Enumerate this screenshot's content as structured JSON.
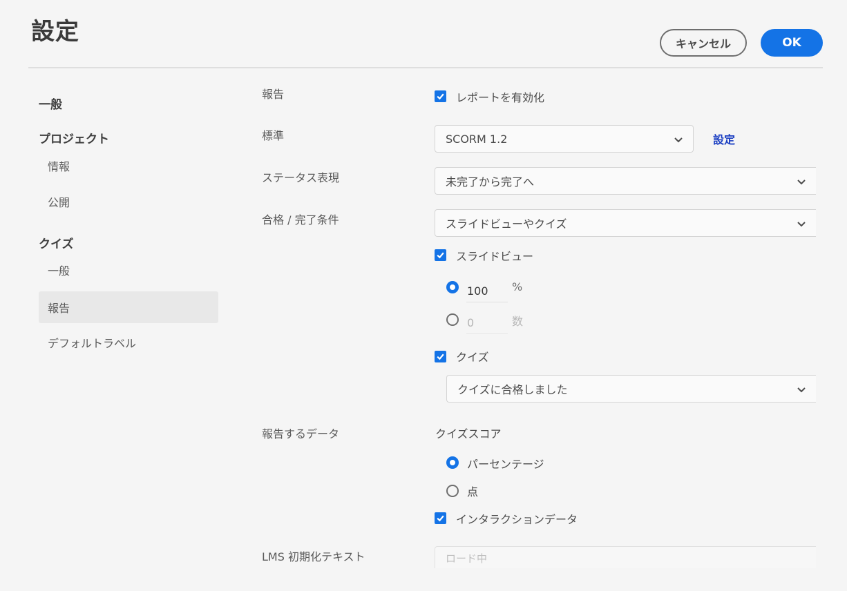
{
  "header": {
    "title": "設定",
    "cancel_label": "キャンセル",
    "ok_label": "OK"
  },
  "sidebar": {
    "general": "一般",
    "project": {
      "label": "プロジェクト",
      "items": [
        "情報",
        "公開"
      ]
    },
    "quiz": {
      "label": "クイズ",
      "items": [
        "一般",
        "報告",
        "デフォルトラベル"
      ],
      "selected": "報告"
    }
  },
  "form": {
    "reporting": {
      "label": "報告",
      "checkbox_label": "レポートを有効化",
      "checked": true
    },
    "standard": {
      "label": "標準",
      "value": "SCORM 1.2",
      "settings_link": "設定"
    },
    "status": {
      "label": "ステータス表現",
      "value": "未完了から完了へ"
    },
    "criteria": {
      "label": "合格 / 完了条件",
      "value": "スライドビューやクイズ",
      "slide_view": {
        "label": "スライドビュー",
        "checked": true,
        "percent_value": "100",
        "percent_unit": "%",
        "count_value": "0",
        "count_unit": "数",
        "selected": "percent"
      },
      "quiz": {
        "label": "クイズ",
        "checked": true,
        "value": "クイズに合格しました"
      }
    },
    "data": {
      "label": "報告するデータ",
      "heading": "クイズスコア",
      "options": [
        "パーセンテージ",
        "点"
      ],
      "selected": "パーセンテージ",
      "interaction_label": "インタラクションデータ",
      "interaction_checked": true
    },
    "lms": {
      "label": "LMS 初期化テキスト",
      "placeholder": "ロード中"
    }
  },
  "colors": {
    "accent": "#1473e6",
    "link": "#1a3ec2",
    "background": "#f5f5f5"
  }
}
